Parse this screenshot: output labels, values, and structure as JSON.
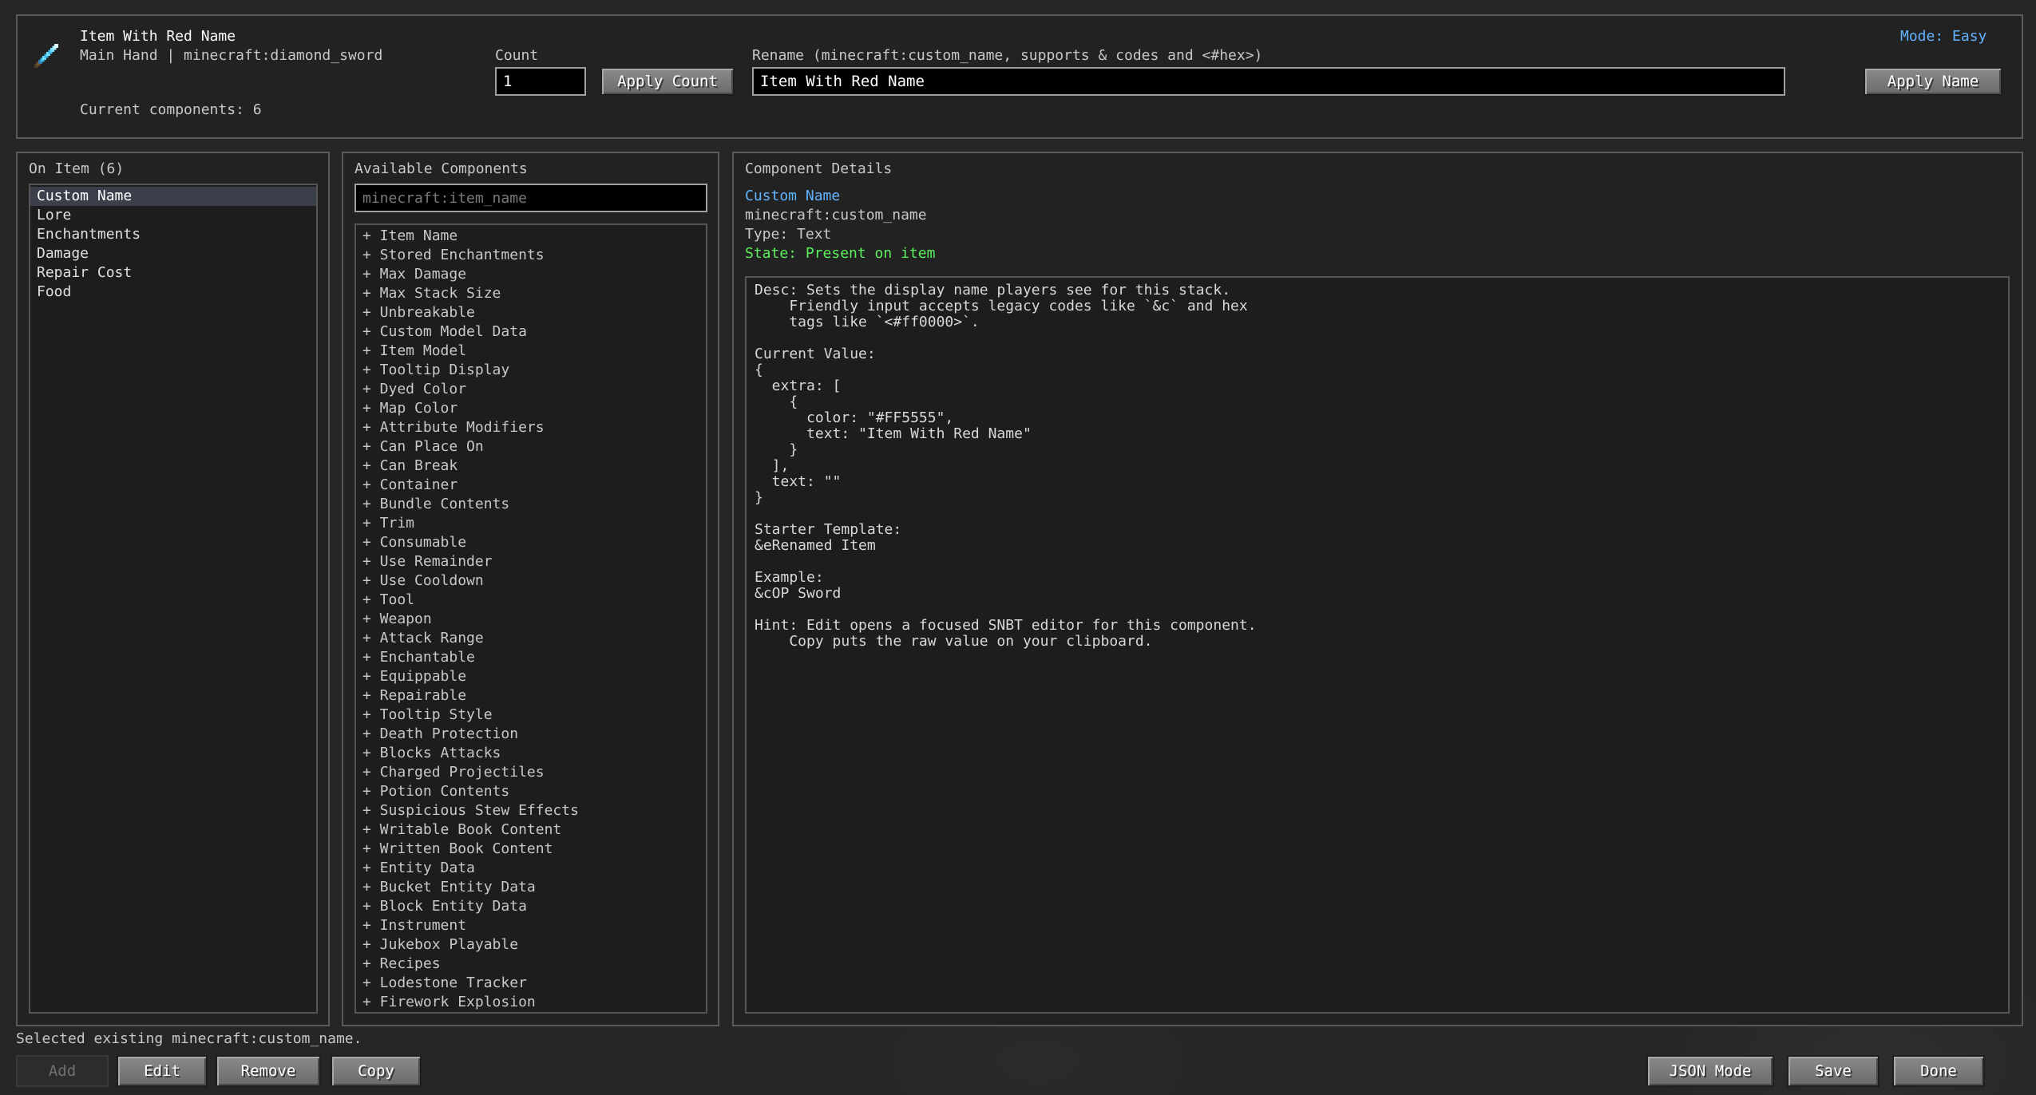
{
  "header": {
    "item_title": "Item With Red Name",
    "item_subtitle": "Main Hand | minecraft:diamond_sword",
    "component_count": "Current components: 6",
    "count_label": "Count",
    "count_value": "1",
    "apply_count_label": "Apply Count",
    "rename_label": "Rename (minecraft:custom_name, supports & codes and <#hex>)",
    "rename_value": "Item With Red Name",
    "mode_label": "Mode: Easy",
    "apply_name_label": "Apply Name"
  },
  "on_item": {
    "title": "On Item (6)",
    "items": [
      "Custom Name",
      "Lore",
      "Enchantments",
      "Damage",
      "Repair Cost",
      "Food"
    ],
    "selected_index": 0
  },
  "available": {
    "title": "Available Components",
    "search_placeholder": "minecraft:item_name",
    "items": [
      "+ Item Name",
      "+ Stored Enchantments",
      "+ Max Damage",
      "+ Max Stack Size",
      "+ Unbreakable",
      "+ Custom Model Data",
      "+ Item Model",
      "+ Tooltip Display",
      "+ Dyed Color",
      "+ Map Color",
      "+ Attribute Modifiers",
      "+ Can Place On",
      "+ Can Break",
      "+ Container",
      "+ Bundle Contents",
      "+ Trim",
      "+ Consumable",
      "+ Use Remainder",
      "+ Use Cooldown",
      "+ Tool",
      "+ Weapon",
      "+ Attack Range",
      "+ Enchantable",
      "+ Equippable",
      "+ Repairable",
      "+ Tooltip Style",
      "+ Death Protection",
      "+ Blocks Attacks",
      "+ Charged Projectiles",
      "+ Potion Contents",
      "+ Suspicious Stew Effects",
      "+ Writable Book Content",
      "+ Written Book Content",
      "+ Entity Data",
      "+ Bucket Entity Data",
      "+ Block Entity Data",
      "+ Instrument",
      "+ Jukebox Playable",
      "+ Recipes",
      "+ Lodestone Tracker",
      "+ Firework Explosion"
    ]
  },
  "details": {
    "title": "Component Details",
    "name": "Custom Name",
    "id": "minecraft:custom_name",
    "type": "Type: Text",
    "state": "State: Present on item",
    "body": "Desc: Sets the display name players see for this stack.\n    Friendly input accepts legacy codes like `&c` and hex\n    tags like `<#ff0000>`.\n\nCurrent Value:\n{\n  extra: [\n    {\n      color: \"#FF5555\",\n      text: \"Item With Red Name\"\n    }\n  ],\n  text: \"\"\n}\n\nStarter Template:\n&eRenamed Item\n\nExample:\n&cOP Sword\n\nHint: Edit opens a focused SNBT editor for this component.\n    Copy puts the raw value on your clipboard."
  },
  "footer": {
    "status": "Selected existing minecraft:custom_name.",
    "add_label": "Add",
    "edit_label": "Edit",
    "remove_label": "Remove",
    "copy_label": "Copy",
    "json_mode_label": "JSON Mode",
    "save_label": "Save",
    "done_label": "Done"
  },
  "colors": {
    "accent_blue": "#63b4ff",
    "state_green": "#5cf05c"
  },
  "icons": {
    "item": "diamond-sword-icon"
  }
}
